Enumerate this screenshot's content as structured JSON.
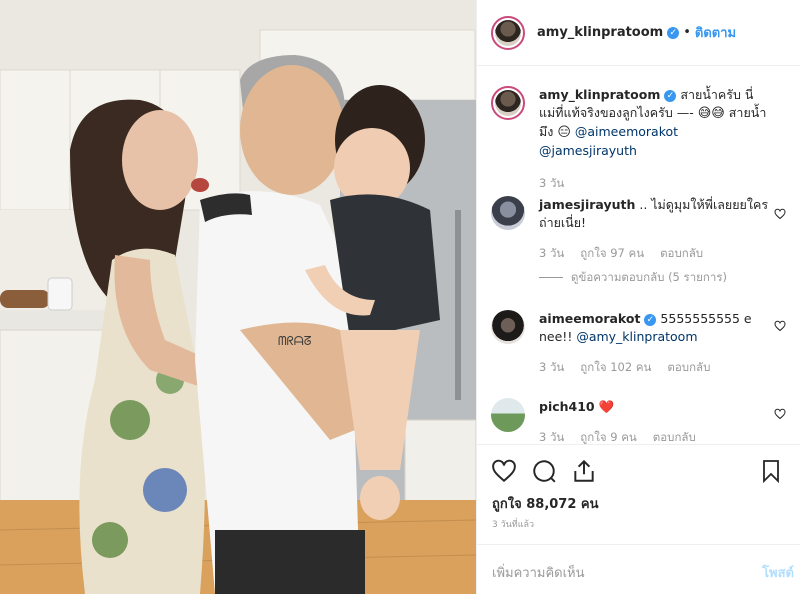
{
  "post": {
    "username": "amy_klinpratoom",
    "follow_label": "ติดตาม",
    "caption_parts": [
      "สายน้ำครับ นี่แม่ที่แท้จริงของลูกไงครับ —- ",
      "😅😅",
      " สายน้ำมึง ",
      "😑",
      " "
    ],
    "caption_mentions": [
      "@aimeemorakot",
      "@jamesjirayuth"
    ],
    "caption_time": "3 วัน",
    "likes_label": "ถูกใจ 88,072 คน",
    "posted_ago": "3 วันที่แล้ว",
    "add_comment_placeholder": "เพิ่มความคิดเห็น",
    "post_label": "โพสต์"
  },
  "comments": [
    {
      "username": "jamesjirayuth",
      "text": " .. ไม่ดูมุมให้พี่เลยยยใครถ่ายเนี่ย!",
      "time": "3 วัน",
      "likes": "ถูกใจ 97 คน",
      "reply": "ตอบกลับ",
      "view_replies": "ดูข้อความตอบกลับ (5 รายการ)"
    },
    {
      "username": "aimeemorakot",
      "text": " 5555555555 e nee!! ",
      "mention": "@amy_klinpratoom",
      "time": "3 วัน",
      "likes": "ถูกใจ 102 คน",
      "reply": "ตอบกลับ"
    },
    {
      "username": "pich410",
      "emoji": "❤️",
      "time": "3 วัน",
      "likes": "ถูกใจ 9 คน",
      "reply": "ตอบกลับ"
    }
  ],
  "icons": {
    "like": "heart-icon",
    "comment": "comment-icon",
    "share": "share-icon",
    "save": "bookmark-icon"
  },
  "colors": {
    "link": "#3897f0",
    "verified": "#3897f0",
    "mention": "#003569",
    "muted": "#999999",
    "story_ring": "#c94a7b"
  }
}
